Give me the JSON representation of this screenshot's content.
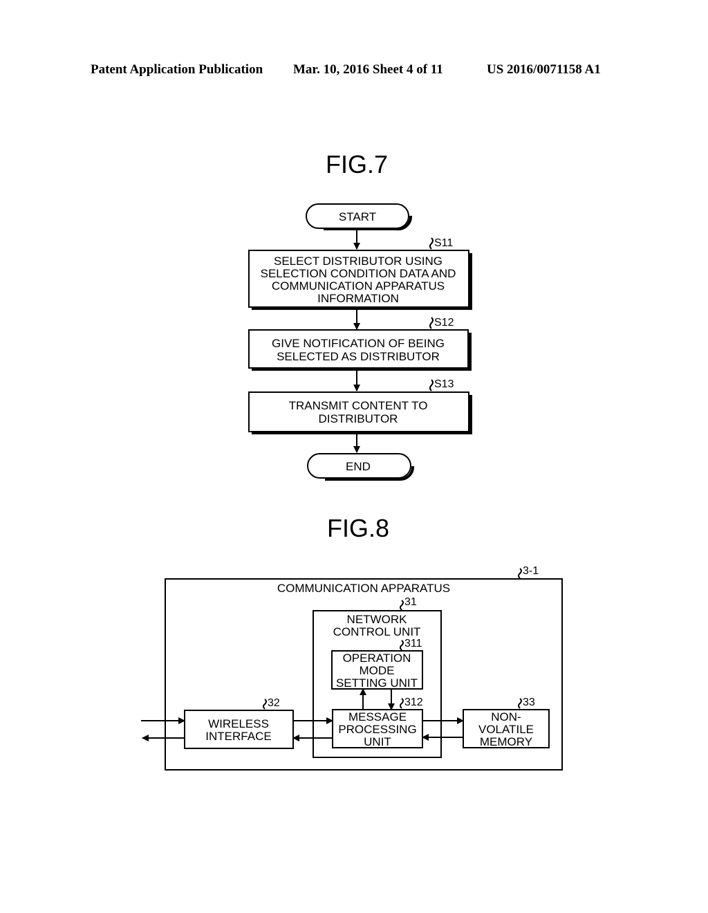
{
  "header": {
    "publication": "Patent Application Publication",
    "date_sheet": "Mar. 10, 2016  Sheet 4 of 11",
    "patent_number": "US 2016/0071158 A1"
  },
  "fig7": {
    "title": "FIG.7",
    "start": "START",
    "end": "END",
    "steps": [
      {
        "ref": "S11",
        "lines": [
          "SELECT DISTRIBUTOR USING",
          "SELECTION CONDITION DATA AND",
          "COMMUNICATION APPARATUS",
          "INFORMATION"
        ]
      },
      {
        "ref": "S12",
        "lines": [
          "GIVE NOTIFICATION OF BEING",
          "SELECTED AS DISTRIBUTOR"
        ]
      },
      {
        "ref": "S13",
        "lines": [
          "TRANSMIT CONTENT TO",
          "DISTRIBUTOR"
        ]
      }
    ]
  },
  "fig8": {
    "title": "FIG.8",
    "apparatus": {
      "ref": "3-1",
      "label": "COMMUNICATION APPARATUS"
    },
    "network_control": {
      "ref": "31",
      "lines": [
        "NETWORK",
        "CONTROL UNIT"
      ]
    },
    "operation_mode": {
      "ref": "311",
      "lines": [
        "OPERATION",
        "MODE",
        "SETTING UNIT"
      ]
    },
    "message_processing": {
      "ref": "312",
      "lines": [
        "MESSAGE",
        "PROCESSING",
        "UNIT"
      ]
    },
    "wireless_interface": {
      "ref": "32",
      "lines": [
        "WIRELESS",
        "INTERFACE"
      ]
    },
    "nonvolatile_memory": {
      "ref": "33",
      "lines": [
        "NON-",
        "VOLATILE",
        "MEMORY"
      ]
    }
  }
}
